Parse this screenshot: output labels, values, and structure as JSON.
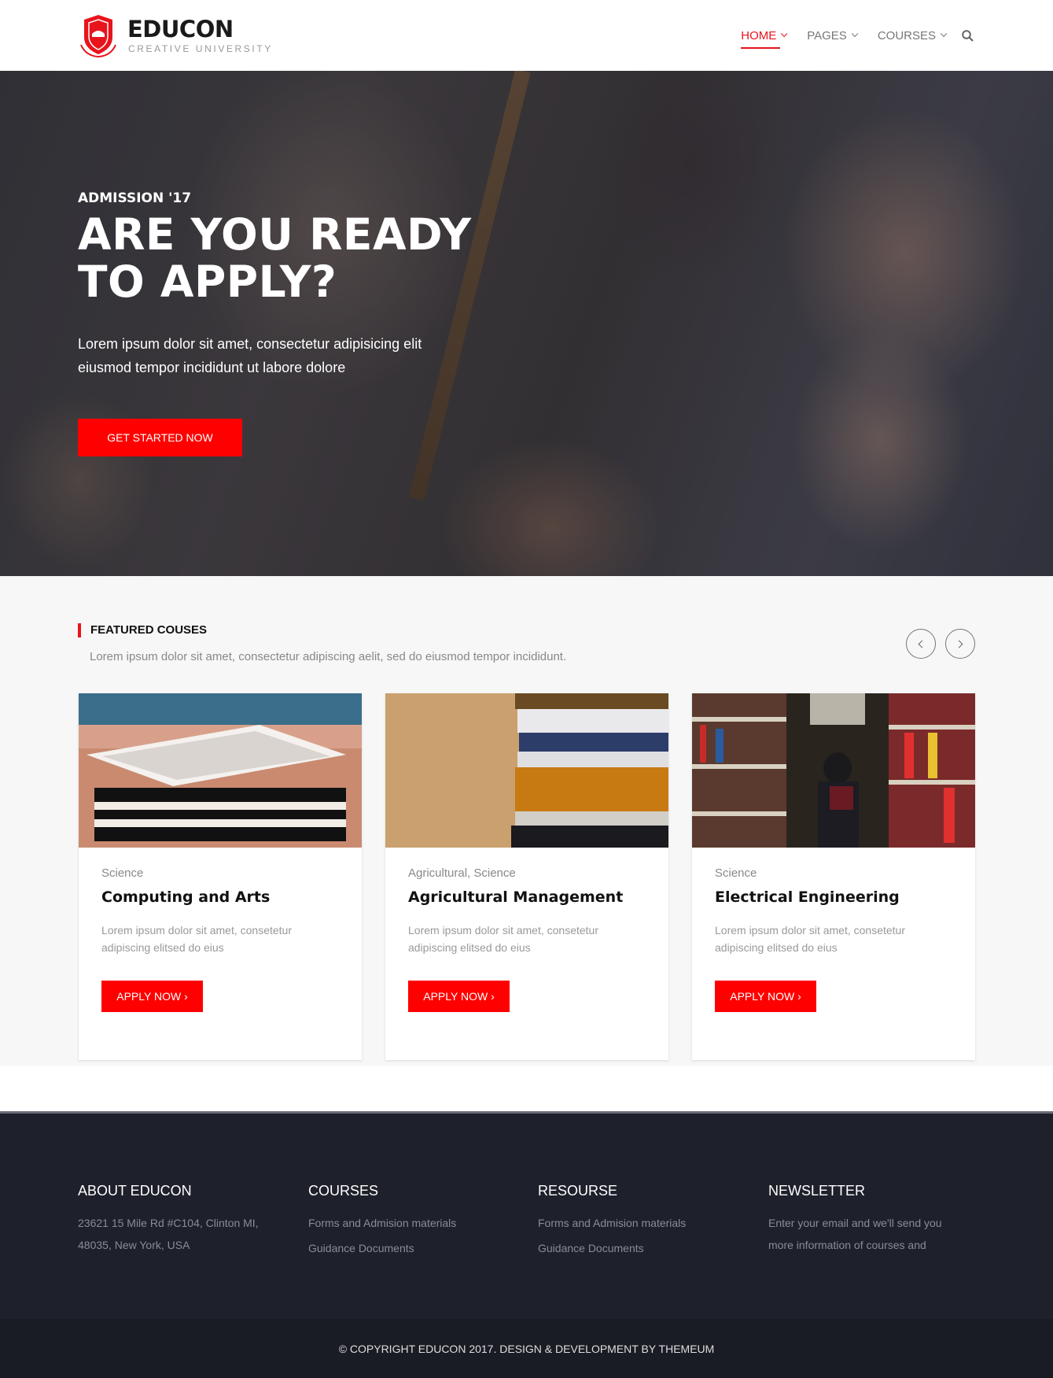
{
  "brand": {
    "name": "EDUCON",
    "tagline": "CREATIVE UNIVERSITY",
    "accent_color": "#e8141c"
  },
  "nav": {
    "items": [
      {
        "label": "HOME",
        "active": true
      },
      {
        "label": "PAGES",
        "active": false
      },
      {
        "label": "COURSES",
        "active": false
      }
    ]
  },
  "hero": {
    "kicker": "ADMISSION '17",
    "title": "ARE YOU READY TO APPLY?",
    "text": "Lorem ipsum dolor sit amet, consectetur adipisicing elit eiusmod tempor incididunt ut labore dolore",
    "button": "GET STARTED NOW"
  },
  "featured": {
    "heading": "FEATURED COUSES",
    "subtitle": "Lorem ipsum dolor sit amet, consectetur adipiscing aelit, sed do eiusmod tempor incididunt.",
    "cards": [
      {
        "category": "Science",
        "title": "Computing and Arts",
        "description": "Lorem ipsum dolor sit amet, consetetur adipiscing elitsed do eius",
        "button": "APPLY NOW ›"
      },
      {
        "category": "Agricultural, Science",
        "title": "Agricultural Management",
        "description": "Lorem ipsum dolor sit amet, consetetur adipiscing elitsed do eius",
        "button": "APPLY NOW ›"
      },
      {
        "category": "Science",
        "title": "Electrical Engineering",
        "description": "Lorem ipsum dolor sit amet, consetetur adipiscing elitsed do eius",
        "button": "APPLY NOW ›"
      }
    ]
  },
  "footer": {
    "about": {
      "title": "ABOUT EDUCON",
      "address_line1": "23621 15 Mile Rd #C104, Clinton MI,",
      "address_line2": "48035, New York, USA"
    },
    "courses": {
      "title": "COURSES",
      "links": [
        "Forms and Admision materials",
        "Guidance Documents"
      ]
    },
    "resource": {
      "title": "RESOURSE",
      "links": [
        "Forms and Admision materials",
        "Guidance Documents"
      ]
    },
    "newsletter": {
      "title": "NEWSLETTER",
      "text": "Enter your email and we'll send you more information of courses and"
    },
    "copyright": "© COPYRIGHT EDUCON 2017. DESIGN & DEVELOPMENT BY THEMEUM"
  }
}
